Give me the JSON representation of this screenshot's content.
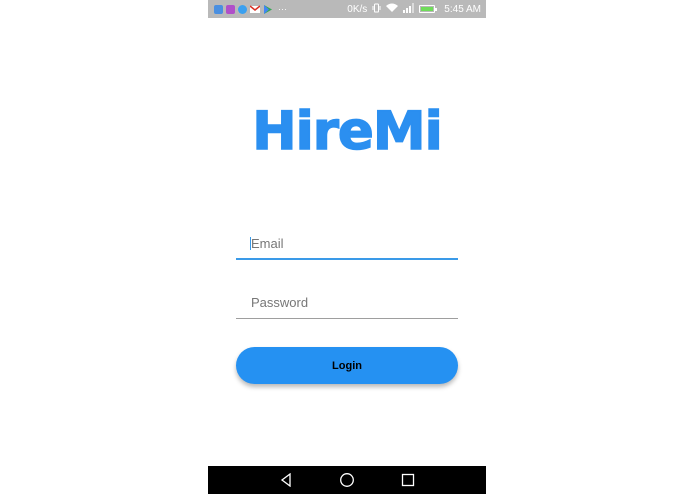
{
  "status_bar": {
    "network_speed": "0K/s",
    "time": "5:45 AM",
    "battery_level_pct": 100,
    "notification_icons": [
      "app-notification-icon",
      "instagram-icon",
      "messenger-icon",
      "gmail-icon",
      "play-store-icon"
    ],
    "more_indicator": "···"
  },
  "app": {
    "logo_text": "HireMi",
    "brand_color": "#2b8ff0"
  },
  "form": {
    "email_placeholder": "Email",
    "email_value": "",
    "password_placeholder": "Password",
    "password_value": "",
    "login_label": "Login",
    "login_color": "#2591f2"
  },
  "nav_bar": {
    "buttons": [
      "back-icon",
      "home-icon",
      "recents-icon"
    ]
  }
}
